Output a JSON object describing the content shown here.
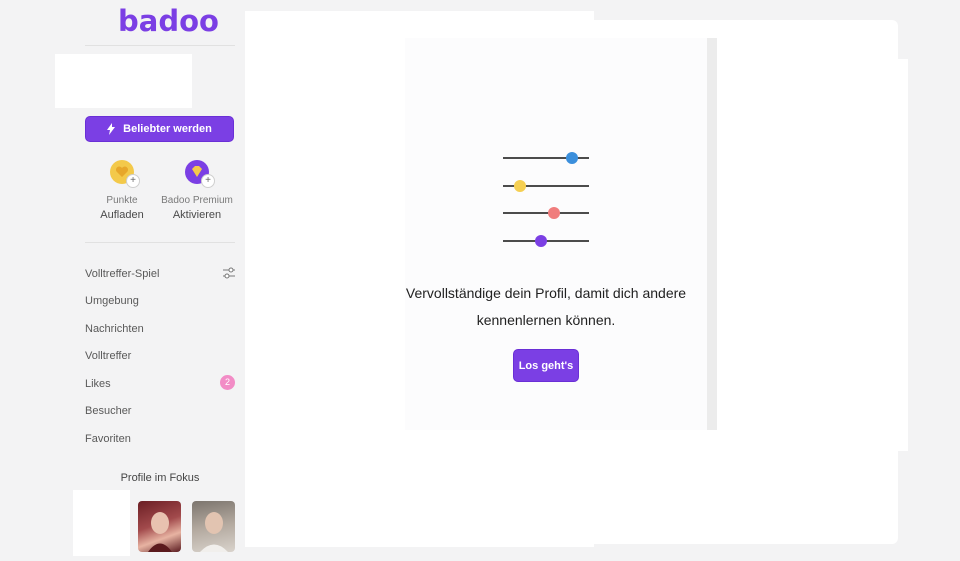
{
  "app": {
    "logo_text": "badoo",
    "brand_color": "#7b3fe4"
  },
  "sidebar": {
    "boost_button_label": "Beliebter werden",
    "tiles": [
      {
        "line1": "Punkte",
        "line2": "Aufladen",
        "icon": "heart-coin-icon",
        "color": "#f3c94a"
      },
      {
        "line1": "Badoo Premium",
        "line2": "Aktivieren",
        "icon": "diamond-icon",
        "color": "#7b3fe4"
      }
    ],
    "nav": [
      {
        "label": "Volltreffer-Spiel",
        "icon": "filter-sliders-icon"
      },
      {
        "label": "Umgebung"
      },
      {
        "label": "Nachrichten"
      },
      {
        "label": "Volltreffer"
      },
      {
        "label": "Likes",
        "badge": "2"
      },
      {
        "label": "Besucher"
      },
      {
        "label": "Favoriten"
      }
    ],
    "profiles_title": "Profile im Fokus"
  },
  "main": {
    "headline": "Vervollständige dein Profil, damit dich andere kennenlernen können.",
    "cta_label": "Los geht's",
    "slider_colors": [
      "#3b8fdc",
      "#f5cf52",
      "#f07d7d",
      "#7b3fe4"
    ]
  }
}
